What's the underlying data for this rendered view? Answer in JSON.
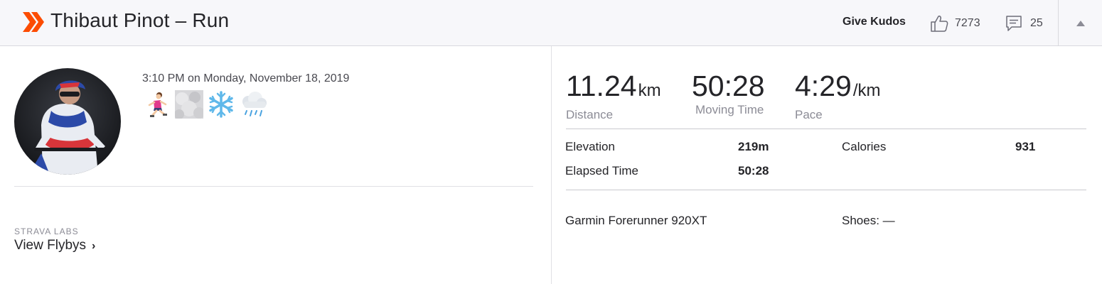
{
  "header": {
    "title": "Thibaut Pinot – Run",
    "give_kudos": "Give Kudos",
    "kudos_count": "7273",
    "comment_count": "25",
    "icons": {
      "logo": "strava-chevron-logo",
      "kudos": "thumbs-up-icon",
      "comment": "comment-icon",
      "collapse": "caret-up-icon"
    },
    "colors": {
      "brand": "#fc4c02"
    }
  },
  "activity": {
    "date": "3:10 PM on Monday, November 18, 2019",
    "icons": [
      "runner-emoji",
      "fog-icon",
      "snowflake-emoji",
      "rain-cloud-emoji"
    ]
  },
  "labs": {
    "label": "STRAVA LABS",
    "link": "View Flybys",
    "chevron": "›"
  },
  "stats": {
    "distance": {
      "value": "11.24",
      "unit": "km",
      "label": "Distance"
    },
    "moving_time": {
      "value": "50:28",
      "unit": "",
      "label": "Moving Time"
    },
    "pace": {
      "value": "4:29",
      "unit": "/km",
      "label": "Pace"
    }
  },
  "details": {
    "elevation": {
      "label": "Elevation",
      "value": "219m"
    },
    "calories": {
      "label": "Calories",
      "value": "931"
    },
    "elapsed_time": {
      "label": "Elapsed Time",
      "value": "50:28"
    }
  },
  "gear": {
    "device": "Garmin Forerunner 920XT",
    "shoes": "Shoes: —"
  }
}
